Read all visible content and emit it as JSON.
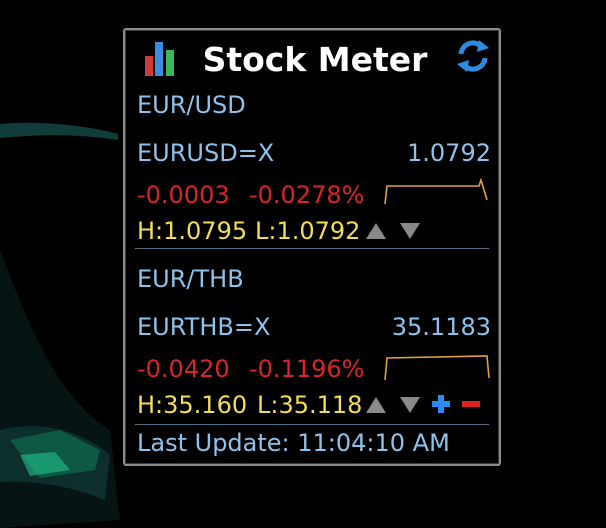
{
  "app": {
    "title": "Stock Meter"
  },
  "quotes": [
    {
      "name": "EUR/USD",
      "symbol": "EURUSD=X",
      "price": "1.0792",
      "change": "-0.0003",
      "change_pct": "-0.0278%",
      "high": "H:1.0795",
      "low": "L:1.0792",
      "sparkline_color": "#e0a040"
    },
    {
      "name": "EUR/THB",
      "symbol": "EURTHB=X",
      "price": "35.1183",
      "change": "-0.0420",
      "change_pct": "-0.1196%",
      "high": "H:35.160",
      "low": "L:35.118",
      "sparkline_color": "#e0a040"
    }
  ],
  "footer": {
    "last_update": "Last Update: 11:04:10 AM"
  },
  "colors": {
    "accent_text": "#8fc2ea",
    "negative": "#d6262a",
    "range_text": "#f2dd58",
    "add": "#2a8cf0",
    "remove": "#e02020"
  },
  "icons": {
    "logo": "bar-chart-icon",
    "refresh": "refresh-icon",
    "up": "arrow-up-icon",
    "down": "arrow-down-icon",
    "add": "plus-icon",
    "remove": "minus-icon"
  }
}
